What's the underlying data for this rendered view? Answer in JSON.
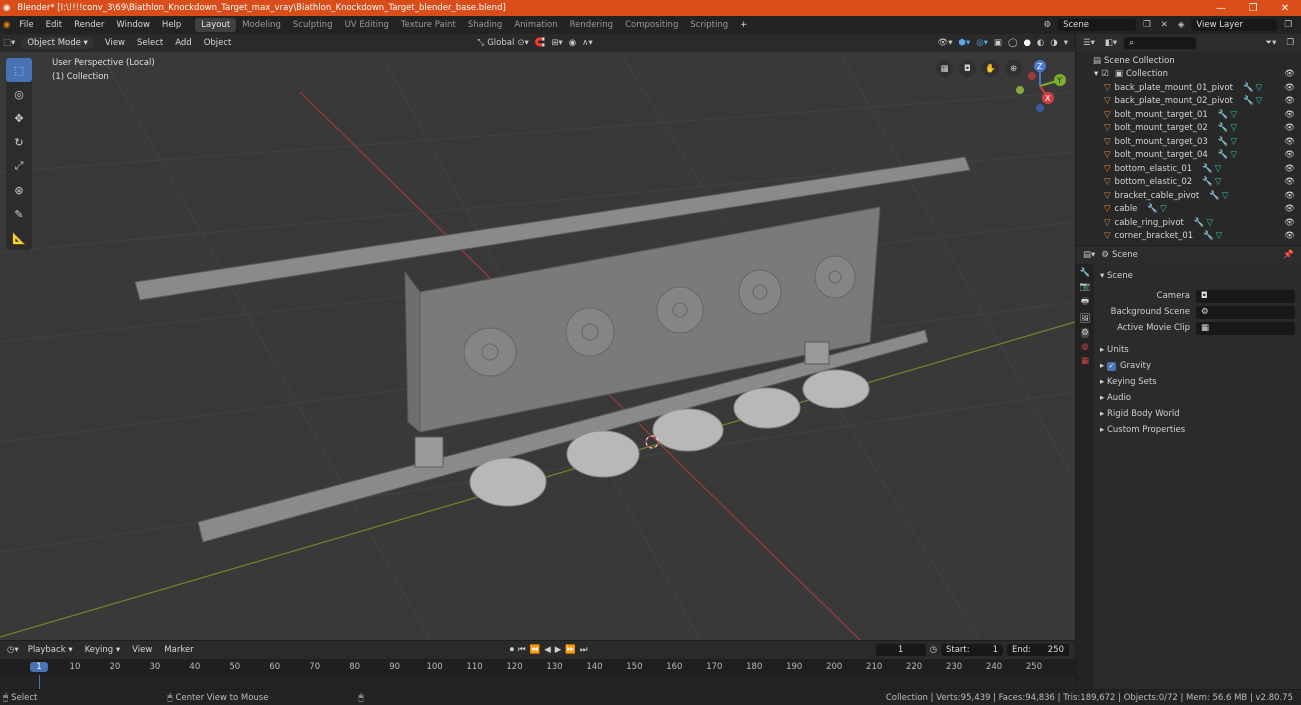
{
  "window": {
    "title": "Blender* [I:\\!!!!conv_3\\69\\Biathlon_Knockdown_Target_max_vray\\Biathlon_Knockdown_Target_blender_base.blend]",
    "minimize": "—",
    "maximize": "❐",
    "close": "✕"
  },
  "menu": {
    "file": "File",
    "edit": "Edit",
    "render": "Render",
    "window": "Window",
    "help": "Help"
  },
  "workspaces": [
    "Layout",
    "Modeling",
    "Sculpting",
    "UV Editing",
    "Texture Paint",
    "Shading",
    "Animation",
    "Rendering",
    "Compositing",
    "Scripting"
  ],
  "scene_field": "Scene",
  "view_layer_field": "View Layer",
  "viewport_header": {
    "mode": "Object Mode",
    "view": "View",
    "select": "Select",
    "add": "Add",
    "object": "Object",
    "orientation": "Global"
  },
  "viewport": {
    "perspective_label": "User Perspective (Local)",
    "collection_label": "(1) Collection",
    "gizmo": {
      "z": "Z",
      "y": "Y",
      "x": "X"
    }
  },
  "outliner": {
    "search_placeholder": "",
    "root": "Scene Collection",
    "collection": "Collection",
    "items": [
      "back_plate_mount_01_pivot",
      "back_plate_mount_02_pivot",
      "bolt_mount_target_01",
      "bolt_mount_target_02",
      "bolt_mount_target_03",
      "bolt_mount_target_04",
      "bottom_elastic_01",
      "bottom_elastic_02",
      "bracket_cable_pivot",
      "cable",
      "cable_ring_pivot",
      "corner_bracket_01"
    ]
  },
  "properties": {
    "header": "Scene",
    "panel": "Scene",
    "camera_label": "Camera",
    "background_scene_label": "Background Scene",
    "active_clip_label": "Active Movie Clip",
    "sections": [
      "Units",
      "Gravity",
      "Keying Sets",
      "Audio",
      "Rigid Body World",
      "Custom Properties"
    ],
    "gravity_checked": true
  },
  "timeline": {
    "playback": "Playback",
    "keying": "Keying",
    "view": "View",
    "marker": "Marker",
    "current_frame": "1",
    "start_label": "Start:",
    "start": "1",
    "end_label": "End:",
    "end": "250",
    "ruler": [
      "1",
      "10",
      "20",
      "30",
      "40",
      "50",
      "60",
      "70",
      "80",
      "90",
      "100",
      "110",
      "120",
      "130",
      "140",
      "150",
      "160",
      "170",
      "180",
      "190",
      "200",
      "210",
      "220",
      "230",
      "240",
      "250"
    ]
  },
  "status": {
    "select": "Select",
    "center": "Center View to Mouse",
    "stats": "Collection | Verts:95,439 | Faces:94,836 | Tris:189,672 | Objects:0/72 | Mem: 56.6 MB | v2.80.75"
  },
  "colors": {
    "accent": "#4772b3",
    "titlebar": "#d94d1a",
    "mesh_icon": "#e8883a",
    "modifier_icon": "#5fa8e8",
    "data_icon": "#33c6a8"
  }
}
